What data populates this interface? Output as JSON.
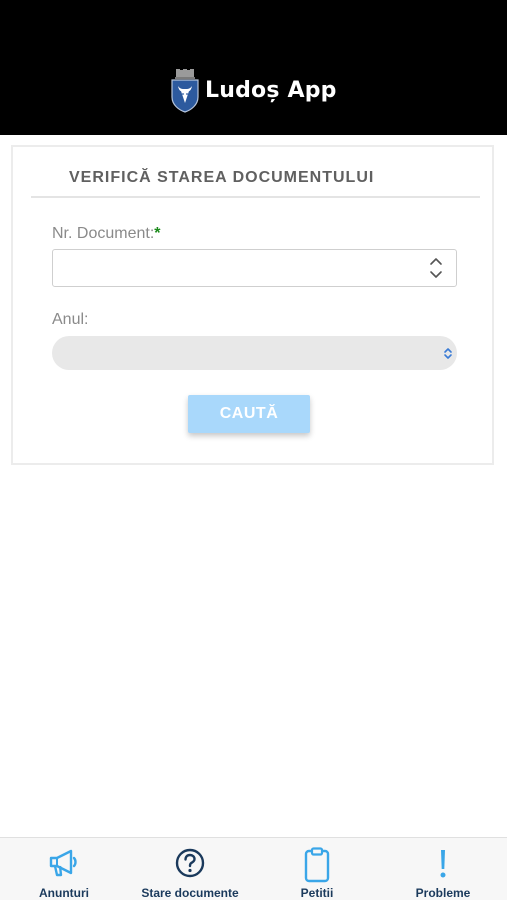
{
  "header": {
    "app_title": "Ludoș App",
    "logo_icon": "city-crest-icon"
  },
  "form": {
    "title": "VERIFICĂ STAREA DOCUMENTULUI",
    "document_number": {
      "label": "Nr. Document:",
      "required_mark": "*",
      "value": "",
      "placeholder": ""
    },
    "year": {
      "label": "Anul:",
      "selected_value": ""
    },
    "search_button_label": "CAUTĂ"
  },
  "bottom_nav": {
    "items": [
      {
        "label": "Anunturi",
        "icon": "megaphone-icon"
      },
      {
        "label": "Stare documente",
        "icon": "question-circle-icon"
      },
      {
        "label": "Petitii",
        "icon": "clipboard-icon"
      },
      {
        "label": "Probleme",
        "icon": "exclamation-icon"
      }
    ]
  },
  "colors": {
    "header_bg": "#000000",
    "button_bg": "#a9d8fb",
    "icon_accent": "#3aa6e8",
    "nav_label": "#1b3a5c",
    "required_mark": "#1a8a1a"
  }
}
